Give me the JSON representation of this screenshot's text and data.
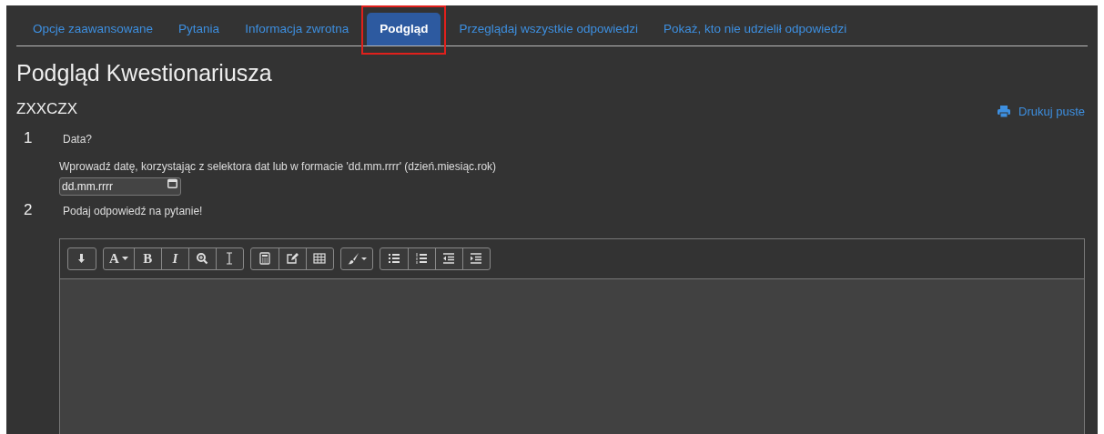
{
  "tabs": [
    {
      "label": "Opcje zaawansowane",
      "selected": false
    },
    {
      "label": "Pytania",
      "selected": false
    },
    {
      "label": "Informacja zwrotna",
      "selected": false
    },
    {
      "label": "Podgląd",
      "selected": true
    },
    {
      "label": "Przeglądaj wszystkie odpowiedzi",
      "selected": false
    },
    {
      "label": "Pokaż, kto nie udzielił odpowiedzi",
      "selected": false
    }
  ],
  "page_title": "Podgląd Kwestionariusza",
  "survey_name": "ZXXCZX",
  "print_link": "Drukuj puste",
  "questions": [
    {
      "number": "1",
      "text": "Data?",
      "kind": "date",
      "hint": "Wprowadź datę, korzystając z selektora dat lub w formacie 'dd.mm.rrrr' (dzień.miesiąc.rok)",
      "placeholder": "dd.mm.rrrr"
    },
    {
      "number": "2",
      "text": "Podaj odpowiedź na pytanie!",
      "kind": "editor",
      "toolbar": [
        [
          {
            "kind": "collapse"
          }
        ],
        [
          {
            "kind": "font-color",
            "label": "A"
          },
          {
            "kind": "bold",
            "label": "B"
          },
          {
            "kind": "italic",
            "label": "I"
          },
          {
            "kind": "zoom"
          },
          {
            "kind": "cursor"
          }
        ],
        [
          {
            "kind": "calculator"
          },
          {
            "kind": "edit"
          },
          {
            "kind": "table"
          }
        ],
        [
          {
            "kind": "brush"
          }
        ],
        [
          {
            "kind": "bullets"
          },
          {
            "kind": "numbers"
          },
          {
            "kind": "outdent"
          },
          {
            "kind": "indent"
          }
        ]
      ]
    }
  ]
}
